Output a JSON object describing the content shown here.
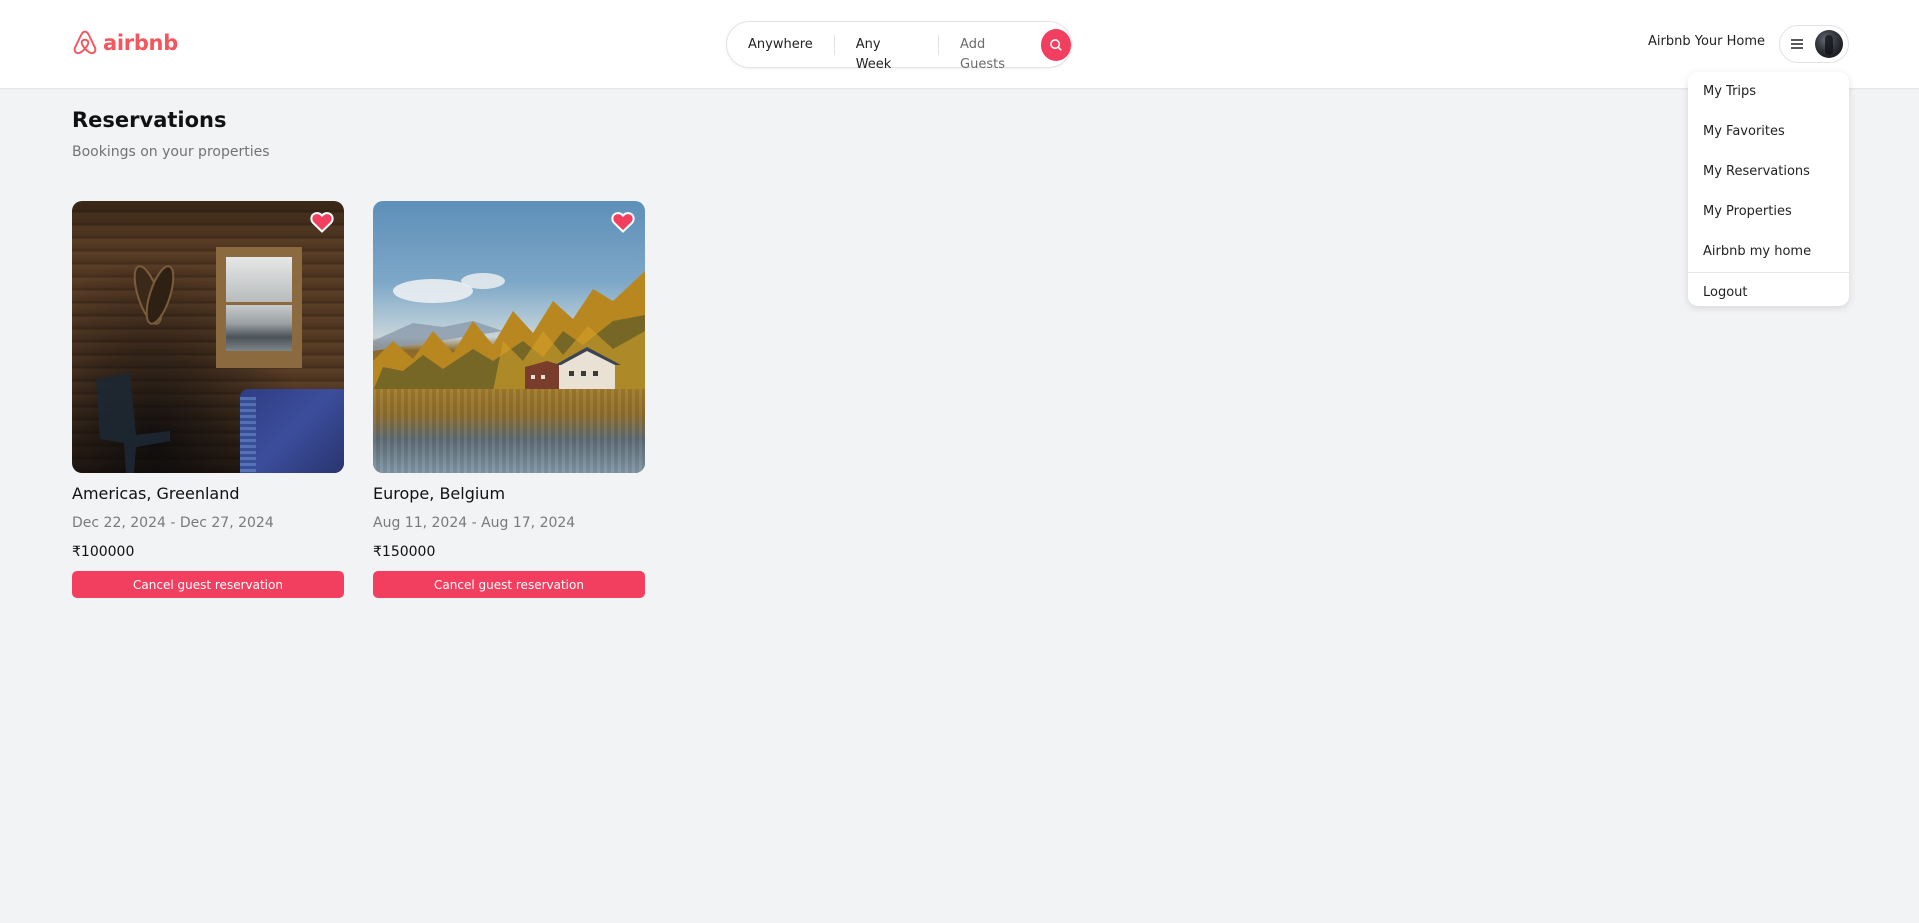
{
  "brand": {
    "name": "airbnb",
    "accent_color": "#f5565e",
    "button_color": "#f23f5f"
  },
  "header": {
    "logo_icon": "airbnb-logo-icon",
    "search": {
      "location": "Anywhere",
      "week": "Any Week",
      "guests_placeholder": "Add Guests",
      "search_icon": "search-icon"
    },
    "host_link": "Airbnb Your Home",
    "user_menu": {
      "menu_icon": "hamburger-menu-icon",
      "avatar_icon": "user-avatar"
    }
  },
  "dropdown": {
    "items": [
      {
        "label": "My Trips"
      },
      {
        "label": "My Favorites"
      },
      {
        "label": "My Reservations"
      },
      {
        "label": "My Properties"
      },
      {
        "label": "Airbnb my home"
      }
    ],
    "logout": "Logout"
  },
  "page": {
    "title": "Reservations",
    "subtitle": "Bookings on your properties"
  },
  "reservations": [
    {
      "location": "Americas, Greenland",
      "dates": "Dec 22, 2024 - Dec 27, 2024",
      "price": "₹100000",
      "favorited": true,
      "image": "cabin interior with window and snowshoes",
      "action": "Cancel guest reservation"
    },
    {
      "location": "Europe, Belgium",
      "dates": "Aug 11, 2024 - Aug 17, 2024",
      "price": "₹150000",
      "favorited": true,
      "image": "lakeside house with autumn forest",
      "action": "Cancel guest reservation"
    }
  ]
}
